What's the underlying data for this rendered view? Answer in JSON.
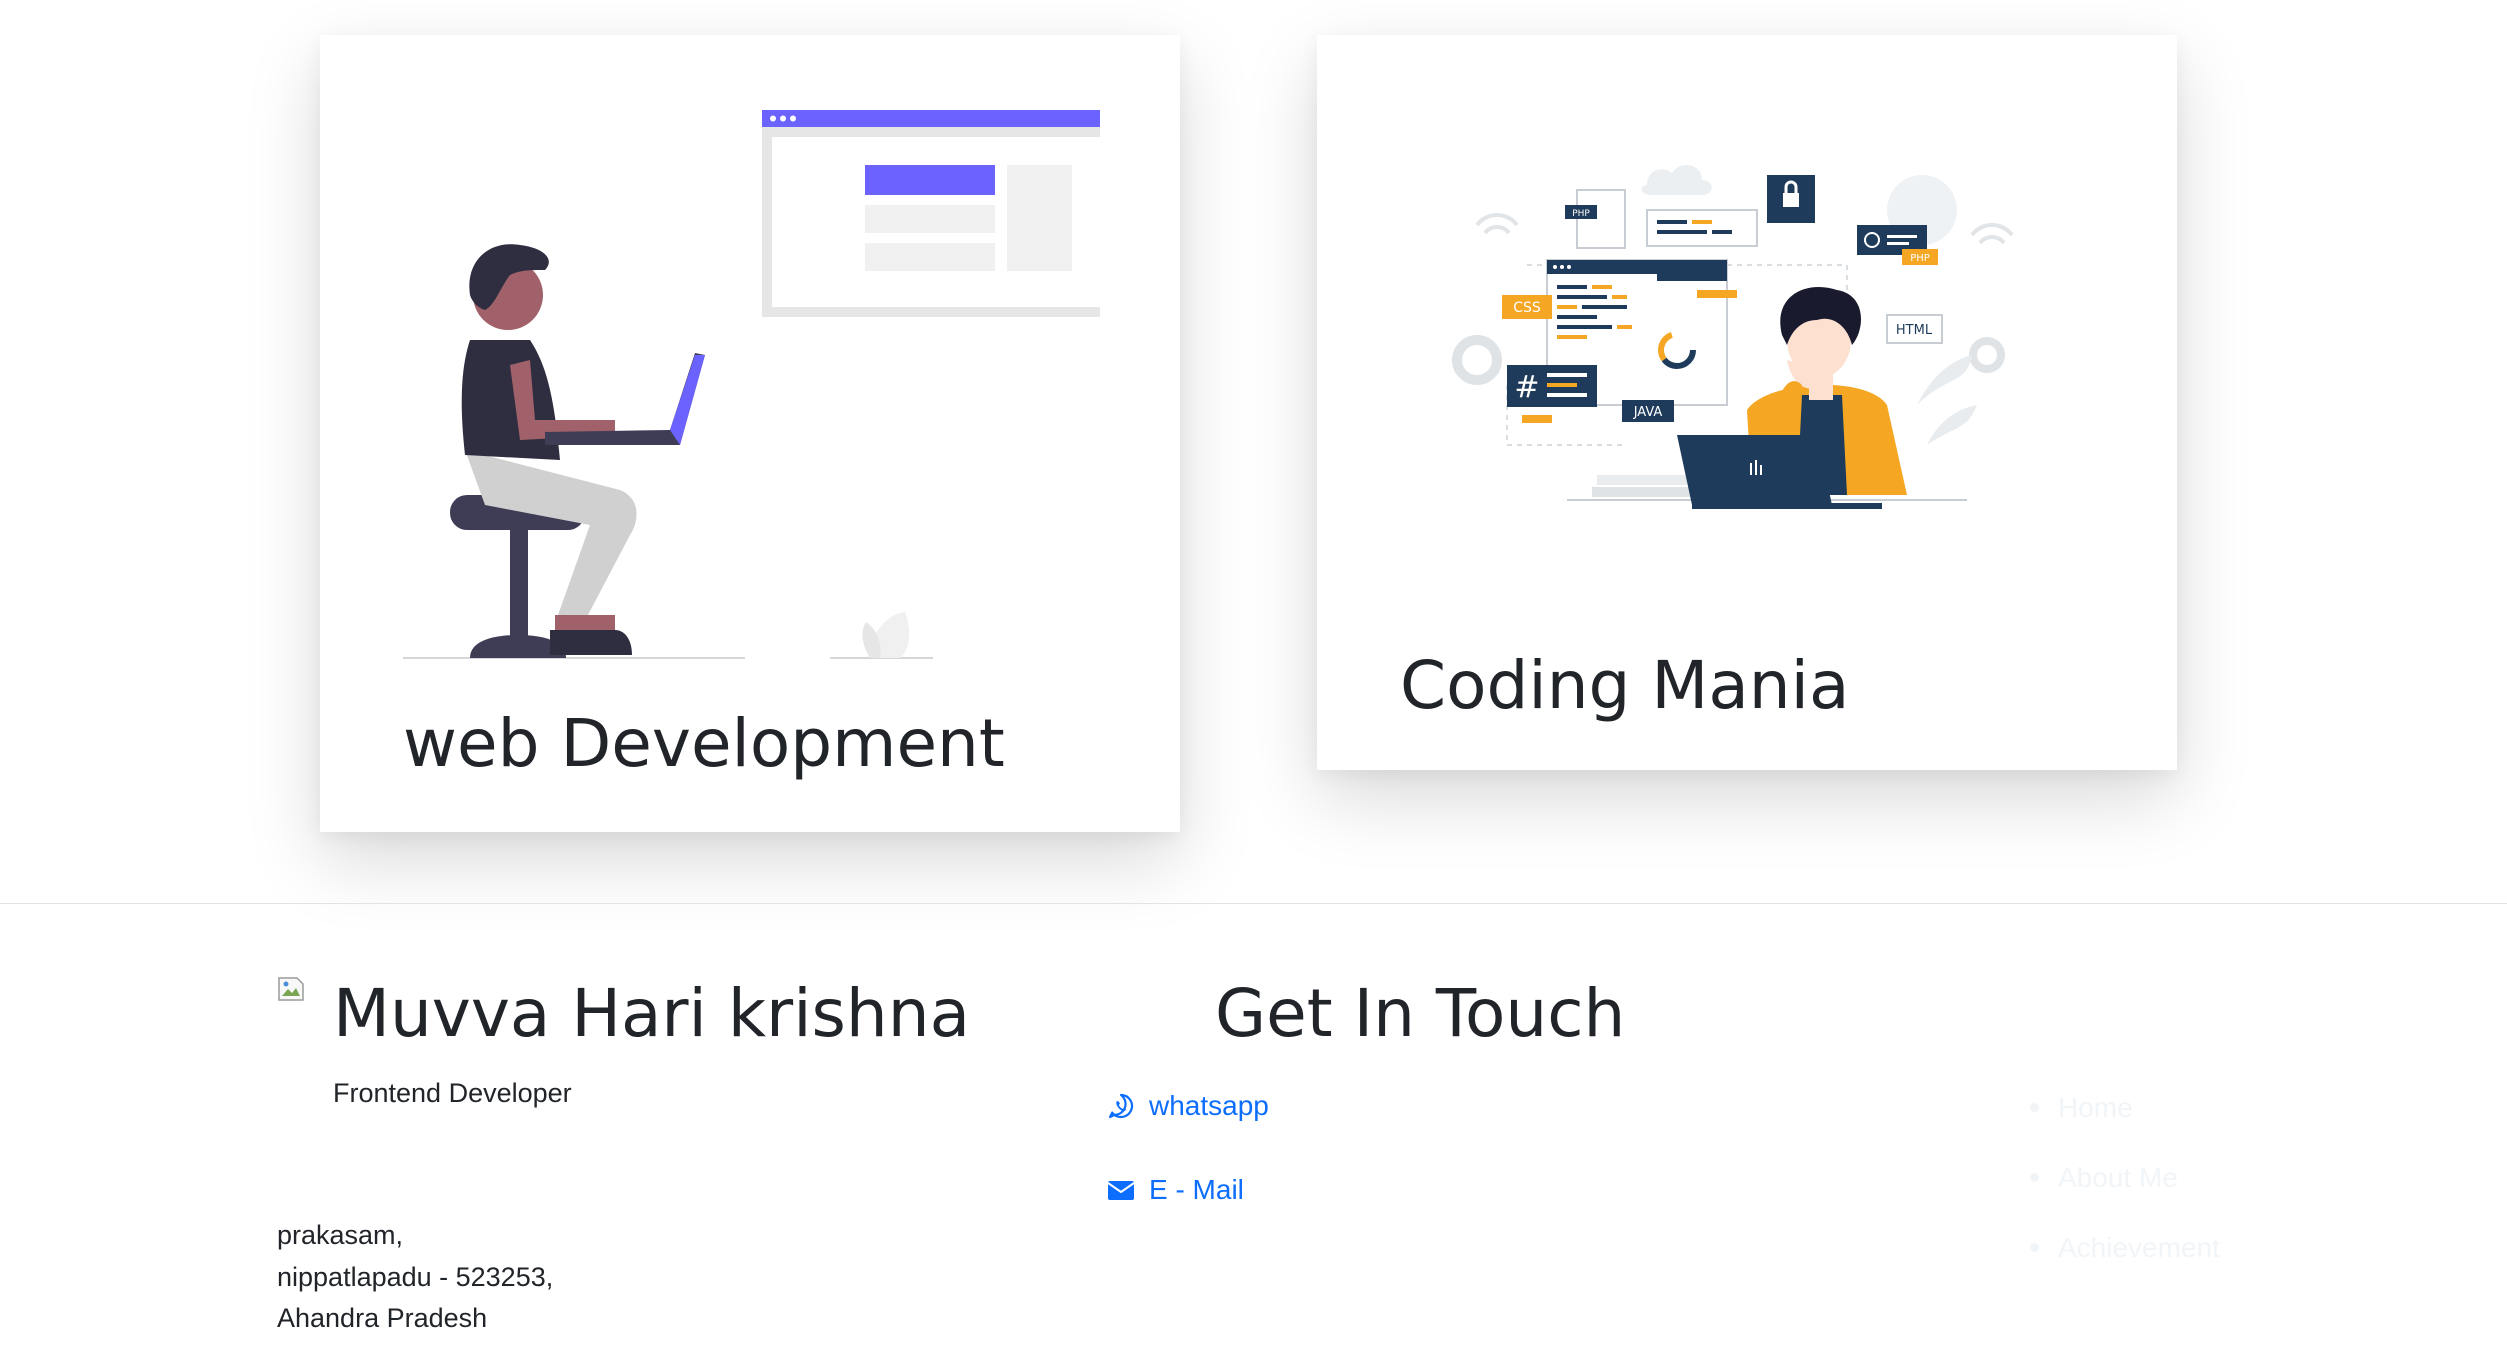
{
  "cards": [
    {
      "title": "web Development",
      "illustration": "person-on-stool-with-laptop"
    },
    {
      "title": "Coding Mania",
      "illustration": "developer-with-laptop-code-icons"
    }
  ],
  "coding_badges": {
    "css": "CSS",
    "html": "HTML",
    "java": "JAVA",
    "php1": "PHP",
    "php2": "PHP"
  },
  "footer": {
    "profile": {
      "name": "Muvva Hari krishna",
      "role": "Frontend Developer",
      "address": [
        "prakasam,",
        "nippatlapadu - 523253,",
        "Ahandra Pradesh"
      ]
    },
    "contact": {
      "heading": "Get In Touch",
      "whatsapp": {
        "label": "whatsapp",
        "icon": "whatsapp-icon"
      },
      "email": {
        "label": "E - Mail",
        "icon": "envelope-icon"
      }
    },
    "nav": [
      "Home",
      "About Me",
      "Achievement"
    ]
  },
  "colors": {
    "accent": "#6c63ff",
    "link": "#0d6efd",
    "navy": "#1f3b5b",
    "orange": "#f5a623",
    "text": "#212529"
  }
}
